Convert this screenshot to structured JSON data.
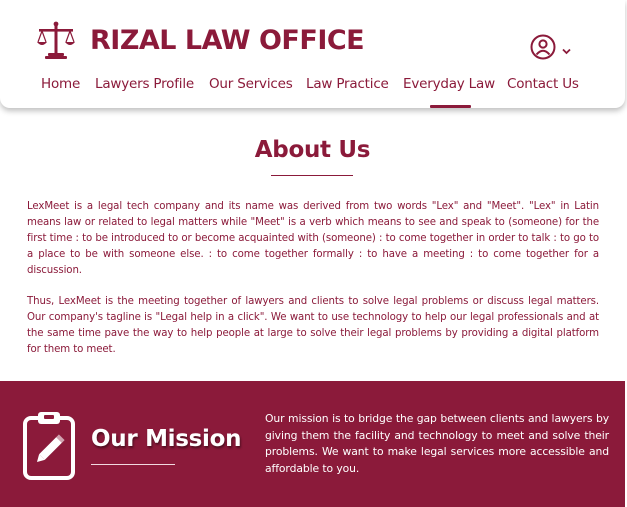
{
  "header": {
    "brand_title": "RIZAL LAW OFFICE",
    "logo_icon": "scales-of-justice-icon",
    "account_icon": "user-circle-icon",
    "account_menu_icon": "chevron-down-icon"
  },
  "nav": {
    "items": [
      {
        "label": "Home"
      },
      {
        "label": "Lawyers Profile"
      },
      {
        "label": "Our Services"
      },
      {
        "label": "Law Practice"
      },
      {
        "label": "Everyday Law"
      },
      {
        "label": "Contact Us"
      }
    ],
    "active": "Everyday Law"
  },
  "about": {
    "title": "About Us",
    "paragraph1": "LexMeet is a legal tech company and its name was derived from two words \"Lex\" and \"Meet\".  \"Lex\" in Latin means law or related to legal matters while \"Meet\" is a verb which means to see and speak to (someone) for the first time : to be introduced to or become acquainted with (someone) : to come together in order to talk : to go to a place to be with someone else. : to come together formally : to have a meeting : to come together for a discussion.",
    "paragraph2": "Thus, LexMeet is the meeting together of lawyers and clients to solve legal problems or discuss legal matters.  Our company's tagline is \"Legal help in a click\". We want to use technology to help our legal professionals and at the same time pave the way to help people at large to solve their legal problems by providing a digital platform for them to meet."
  },
  "mission": {
    "title": "Our Mission",
    "icon": "clipboard-edit-icon",
    "text": "Our mission is to bridge the gap between clients and lawyers by giving them the facility and technology to meet and solve their problems. We want to make legal services more accessible and affordable to you."
  },
  "colors": {
    "brand": "#8b1a3a",
    "background": "#ffffff",
    "mission_text": "#ffffff"
  }
}
